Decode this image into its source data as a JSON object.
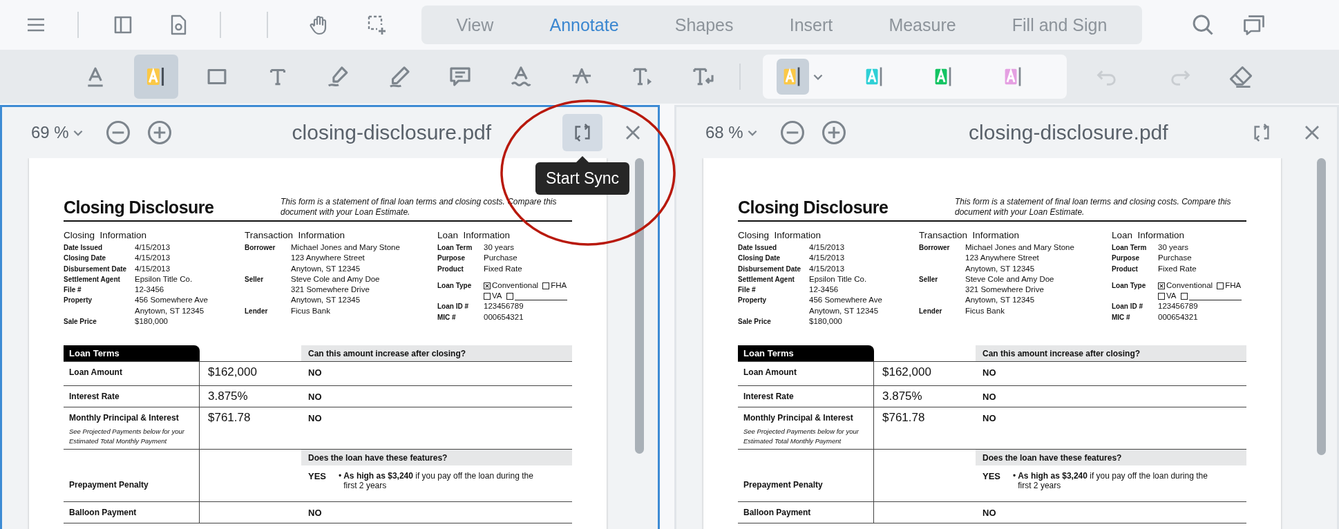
{
  "top_bar": {
    "tabs": [
      {
        "label": "View",
        "selected": false
      },
      {
        "label": "Annotate",
        "selected": true
      },
      {
        "label": "Shapes",
        "selected": false
      },
      {
        "label": "Insert",
        "selected": false
      },
      {
        "label": "Measure",
        "selected": false
      },
      {
        "label": "Fill and Sign",
        "selected": false
      }
    ]
  },
  "annotation_toolbar": {
    "tools": [
      {
        "kind": "underline",
        "selected": false
      },
      {
        "kind": "highlight",
        "selected": true
      },
      {
        "kind": "rectangle",
        "selected": false
      },
      {
        "kind": "free_text",
        "selected": false
      },
      {
        "kind": "highlighter_pen",
        "selected": false
      },
      {
        "kind": "pencil",
        "selected": false
      },
      {
        "kind": "comment",
        "selected": false
      },
      {
        "kind": "squiggly",
        "selected": false
      },
      {
        "kind": "strikeout",
        "selected": false
      },
      {
        "kind": "text_insert",
        "selected": false
      },
      {
        "kind": "text_replace",
        "selected": false
      }
    ],
    "colors": [
      {
        "color": "#fbc846",
        "selected": true
      },
      {
        "color": "#2fd0d6",
        "selected": false
      },
      {
        "color": "#14c463",
        "selected": false
      },
      {
        "color": "#e5a0e2",
        "selected": false
      }
    ],
    "undo": {
      "disabled": true
    },
    "redo": {
      "disabled": true
    }
  },
  "panes": [
    {
      "zoom": "69 %",
      "file_name": "closing-disclosure.pdf",
      "active": true,
      "sync_hovered": true,
      "tooltip": "Start Sync",
      "callout": true,
      "document": {
        "title": "Closing Disclosure",
        "intro": "This form is a statement of final loan terms and closing costs. Compare this document with your Loan Estimate.",
        "info_sections": [
          {
            "heading": "Closing  Information",
            "rows": [
              {
                "kind": "text",
                "label": "Date Issued",
                "lines": [
                  "4/15/2013"
                ]
              },
              {
                "kind": "text",
                "label": "Closing Date",
                "lines": [
                  "4/15/2013"
                ]
              },
              {
                "kind": "text",
                "label": "Disbursement Date",
                "lines": [
                  "4/15/2013"
                ]
              },
              {
                "kind": "text",
                "label": "Settlement Agent",
                "lines": [
                  "Epsilon Title Co."
                ]
              },
              {
                "kind": "text",
                "label": "File #",
                "lines": [
                  "12-3456"
                ]
              },
              {
                "kind": "text",
                "label": "Property",
                "lines": [
                  "456 Somewhere Ave",
                  "Anytown, ST 12345"
                ]
              },
              {
                "kind": "text",
                "label": "Sale Price",
                "lines": [
                  "$180,000"
                ]
              }
            ]
          },
          {
            "heading": "Transaction  Information",
            "rows": [
              {
                "kind": "text",
                "label": "Borrower",
                "lines": [
                  "Michael Jones and Mary Stone",
                  "123 Anywhere Street",
                  "Anytown, ST 12345"
                ]
              },
              {
                "kind": "text",
                "label": "Seller",
                "lines": [
                  "Steve Cole and Amy Doe",
                  "321 Somewhere Drive",
                  "Anytown, ST 12345"
                ]
              },
              {
                "kind": "text",
                "label": "Lender",
                "lines": [
                  "Ficus Bank"
                ]
              }
            ]
          },
          {
            "heading": "Loan  Information",
            "rows": [
              {
                "kind": "text",
                "label": "Loan Term",
                "lines": [
                  "30 years"
                ]
              },
              {
                "kind": "text",
                "label": "Purpose",
                "lines": [
                  "Purchase"
                ]
              },
              {
                "kind": "text",
                "label": "Product",
                "lines": [
                  "Fixed Rate"
                ]
              },
              {
                "kind": "checkboxes",
                "label": "Loan Type",
                "options": [
                  {
                    "kind": "labelled",
                    "label": "Conventional",
                    "checked": true
                  },
                  {
                    "kind": "labelled",
                    "label": "FHA",
                    "checked": false
                  },
                  {
                    "kind": "labelled",
                    "label": "VA",
                    "checked": false
                  },
                  {
                    "kind": "fill_in",
                    "checked": false
                  }
                ]
              },
              {
                "kind": "text",
                "label": "Loan ID #",
                "lines": [
                  "123456789"
                ]
              },
              {
                "kind": "text",
                "label": "MIC #",
                "lines": [
                  "000654321"
                ]
              }
            ]
          }
        ],
        "loan_terms": {
          "tab": "Loan Terms",
          "question": "Can this amount increase after closing?",
          "rows": [
            {
              "kind": "item",
              "label": "Loan Amount",
              "value": "$162,000",
              "answer": "NO"
            },
            {
              "kind": "item",
              "label": "Interest Rate",
              "value": "3.875%",
              "answer": "NO"
            },
            {
              "kind": "item",
              "label": "Monthly Principal & Interest",
              "note": "See Projected Payments below for your Estimated Total Monthly Payment",
              "value": "$761.78",
              "answer": "NO"
            },
            {
              "kind": "question",
              "text": "Does the loan have these features?"
            },
            {
              "kind": "item",
              "label": "Prepayment Penalty",
              "answer": "YES",
              "bullet": "•",
              "detail": "**As high as $3,240** if you pay off the loan during the first 2 years"
            },
            {
              "kind": "item",
              "label": "Balloon Payment",
              "answer": "NO"
            }
          ]
        }
      }
    },
    {
      "zoom": "68 %",
      "file_name": "closing-disclosure.pdf",
      "active": false,
      "sync_hovered": false,
      "callout": false,
      "document": {
        "title": "Closing Disclosure",
        "intro": "This form is a statement of final loan terms and closing costs. Compare this document with your Loan Estimate.",
        "info_sections": [
          {
            "heading": "Closing  Information",
            "rows": [
              {
                "kind": "text",
                "label": "Date Issued",
                "lines": [
                  "4/15/2013"
                ]
              },
              {
                "kind": "text",
                "label": "Closing Date",
                "lines": [
                  "4/15/2013"
                ]
              },
              {
                "kind": "text",
                "label": "Disbursement Date",
                "lines": [
                  "4/15/2013"
                ]
              },
              {
                "kind": "text",
                "label": "Settlement Agent",
                "lines": [
                  "Epsilon Title Co."
                ]
              },
              {
                "kind": "text",
                "label": "File #",
                "lines": [
                  "12-3456"
                ]
              },
              {
                "kind": "text",
                "label": "Property",
                "lines": [
                  "456 Somewhere Ave",
                  "Anytown, ST 12345"
                ]
              },
              {
                "kind": "text",
                "label": "Sale Price",
                "lines": [
                  "$180,000"
                ]
              }
            ]
          },
          {
            "heading": "Transaction  Information",
            "rows": [
              {
                "kind": "text",
                "label": "Borrower",
                "lines": [
                  "Michael Jones and Mary Stone",
                  "123 Anywhere Street",
                  "Anytown, ST 12345"
                ]
              },
              {
                "kind": "text",
                "label": "Seller",
                "lines": [
                  "Steve Cole and Amy Doe",
                  "321 Somewhere Drive",
                  "Anytown, ST 12345"
                ]
              },
              {
                "kind": "text",
                "label": "Lender",
                "lines": [
                  "Ficus Bank"
                ]
              }
            ]
          },
          {
            "heading": "Loan  Information",
            "rows": [
              {
                "kind": "text",
                "label": "Loan Term",
                "lines": [
                  "30 years"
                ]
              },
              {
                "kind": "text",
                "label": "Purpose",
                "lines": [
                  "Purchase"
                ]
              },
              {
                "kind": "text",
                "label": "Product",
                "lines": [
                  "Fixed Rate"
                ]
              },
              {
                "kind": "checkboxes",
                "label": "Loan Type",
                "options": [
                  {
                    "kind": "labelled",
                    "label": "Conventional",
                    "checked": true
                  },
                  {
                    "kind": "labelled",
                    "label": "FHA",
                    "checked": false
                  },
                  {
                    "kind": "labelled",
                    "label": "VA",
                    "checked": false
                  },
                  {
                    "kind": "fill_in",
                    "checked": false
                  }
                ]
              },
              {
                "kind": "text",
                "label": "Loan ID #",
                "lines": [
                  "123456789"
                ]
              },
              {
                "kind": "text",
                "label": "MIC #",
                "lines": [
                  "000654321"
                ]
              }
            ]
          }
        ],
        "loan_terms": {
          "tab": "Loan Terms",
          "question": "Can this amount increase after closing?",
          "rows": [
            {
              "kind": "item",
              "label": "Loan Amount",
              "value": "$162,000",
              "answer": "NO"
            },
            {
              "kind": "item",
              "label": "Interest Rate",
              "value": "3.875%",
              "answer": "NO"
            },
            {
              "kind": "item",
              "label": "Monthly Principal & Interest",
              "note": "See Projected Payments below for your Estimated Total Monthly Payment",
              "value": "$761.78",
              "answer": "NO"
            },
            {
              "kind": "question",
              "text": "Does the loan have these features?"
            },
            {
              "kind": "item",
              "label": "Prepayment Penalty",
              "answer": "YES",
              "bullet": "•",
              "detail": "**As high as $3,240** if you pay off the loan during the first 2 years"
            },
            {
              "kind": "item",
              "label": "Balloon Payment",
              "answer": "NO"
            }
          ]
        }
      }
    }
  ]
}
